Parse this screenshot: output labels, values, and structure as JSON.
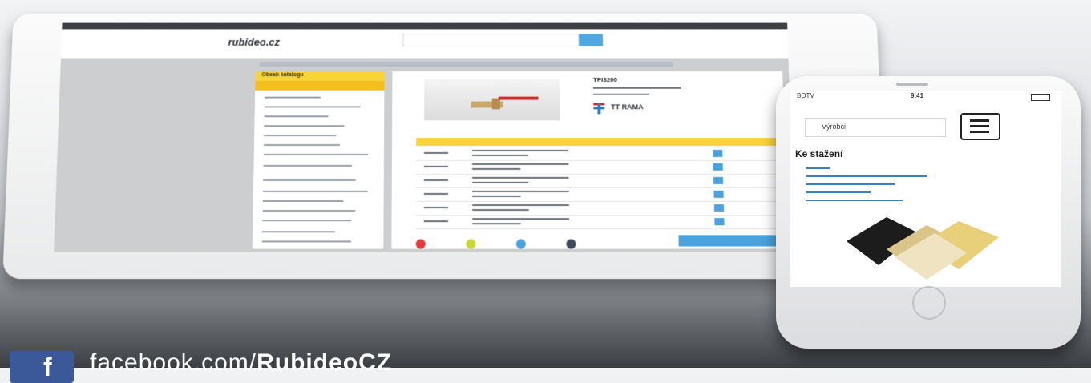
{
  "tablet": {
    "logo": "rubideo.cz",
    "sidebar_header": "Obsah katalogu",
    "product_title": "TPI3200",
    "brand": "TT RAMA"
  },
  "phone": {
    "status": {
      "carrier": "BOTV",
      "time": "9:41",
      "battery": ""
    },
    "nav_label": "Výrobci",
    "heading": "Ke stažení"
  },
  "facebook": {
    "prefix": "facebook.com/",
    "handle": "RubideoCZ"
  },
  "colors": {
    "accent_yellow": "#f9d33a",
    "accent_blue": "#4aa3df",
    "facebook_blue": "#3b5998"
  }
}
